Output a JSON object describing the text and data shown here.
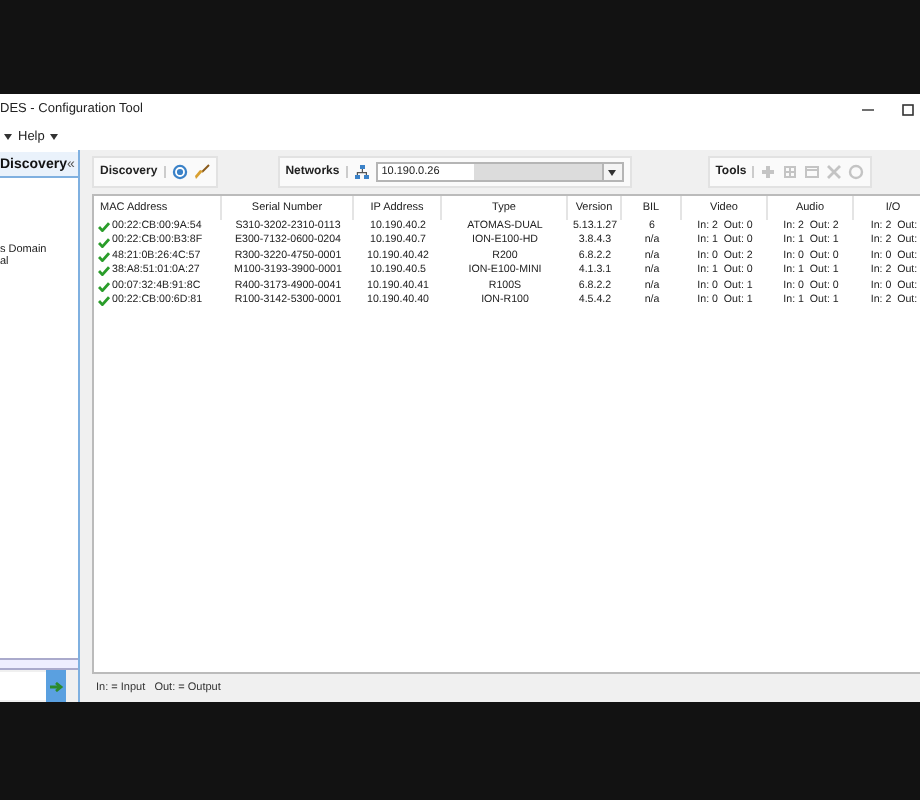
{
  "window": {
    "title": "DES - Configuration Tool"
  },
  "menu": {
    "items": [
      {
        "label": "Help"
      }
    ]
  },
  "sidebar": {
    "title": "Discovery",
    "collapse": "«",
    "items": [
      {
        "label": "s Domain"
      },
      {
        "label": "al"
      }
    ]
  },
  "toolbar": {
    "discovery_label": "Discovery",
    "networks_label": "Networks",
    "network": "10.190.0.26",
    "tools_label": "Tools",
    "tools": [
      {
        "kind": "plus",
        "disabled": true
      },
      {
        "kind": "grid",
        "disabled": true
      },
      {
        "kind": "window",
        "disabled": true
      },
      {
        "kind": "cross",
        "disabled": true
      },
      {
        "kind": "circle",
        "disabled": true
      }
    ]
  },
  "table": {
    "columns": [
      "MAC Address",
      "Serial Number",
      "IP Address",
      "Type",
      "Version",
      "BIL",
      "Video",
      "Audio",
      "I/O"
    ],
    "rows": [
      {
        "cells": [
          "00:22:CB:00:9A:54",
          "S310-3202-2310-0113",
          "10.190.40.2",
          "ATOMAS-DUAL",
          "5.13.1.27",
          "6",
          "In: 2  Out: 0",
          "In: 2  Out: 2",
          "In: 2  Out:"
        ]
      },
      {
        "cells": [
          "00:22:CB:00:B3:8F",
          "E300-7132-0600-0204",
          "10.190.40.7",
          "ION-E100-HD",
          "3.8.4.3",
          "n/a",
          "In: 1  Out: 0",
          "In: 1  Out: 1",
          "In: 2  Out:"
        ]
      },
      {
        "cells": [
          "48:21:0B:26:4C:57",
          "R300-3220-4750-0001",
          "10.190.40.42",
          "R200",
          "6.8.2.2",
          "n/a",
          "In: 0  Out: 2",
          "In: 0  Out: 0",
          "In: 0  Out:"
        ]
      },
      {
        "cells": [
          "38:A8:51:01:0A:27",
          "M100-3193-3900-0001",
          "10.190.40.5",
          "ION-E100-MINI",
          "4.1.3.1",
          "n/a",
          "In: 1  Out: 0",
          "In: 1  Out: 1",
          "In: 2  Out:"
        ]
      },
      {
        "cells": [
          "00:07:32:4B:91:8C",
          "R400-3173-4900-0041",
          "10.190.40.41",
          "R100S",
          "6.8.2.2",
          "n/a",
          "In: 0  Out: 1",
          "In: 0  Out: 0",
          "In: 0  Out:"
        ]
      },
      {
        "cells": [
          "00:22:CB:00:6D:81",
          "R100-3142-5300-0001",
          "10.190.40.40",
          "ION-R100",
          "4.5.4.2",
          "n/a",
          "In: 0  Out: 1",
          "In: 1  Out: 1",
          "In: 2  Out:"
        ]
      }
    ]
  },
  "status_bar": {
    "text": "In: = Input   Out: = Output"
  }
}
